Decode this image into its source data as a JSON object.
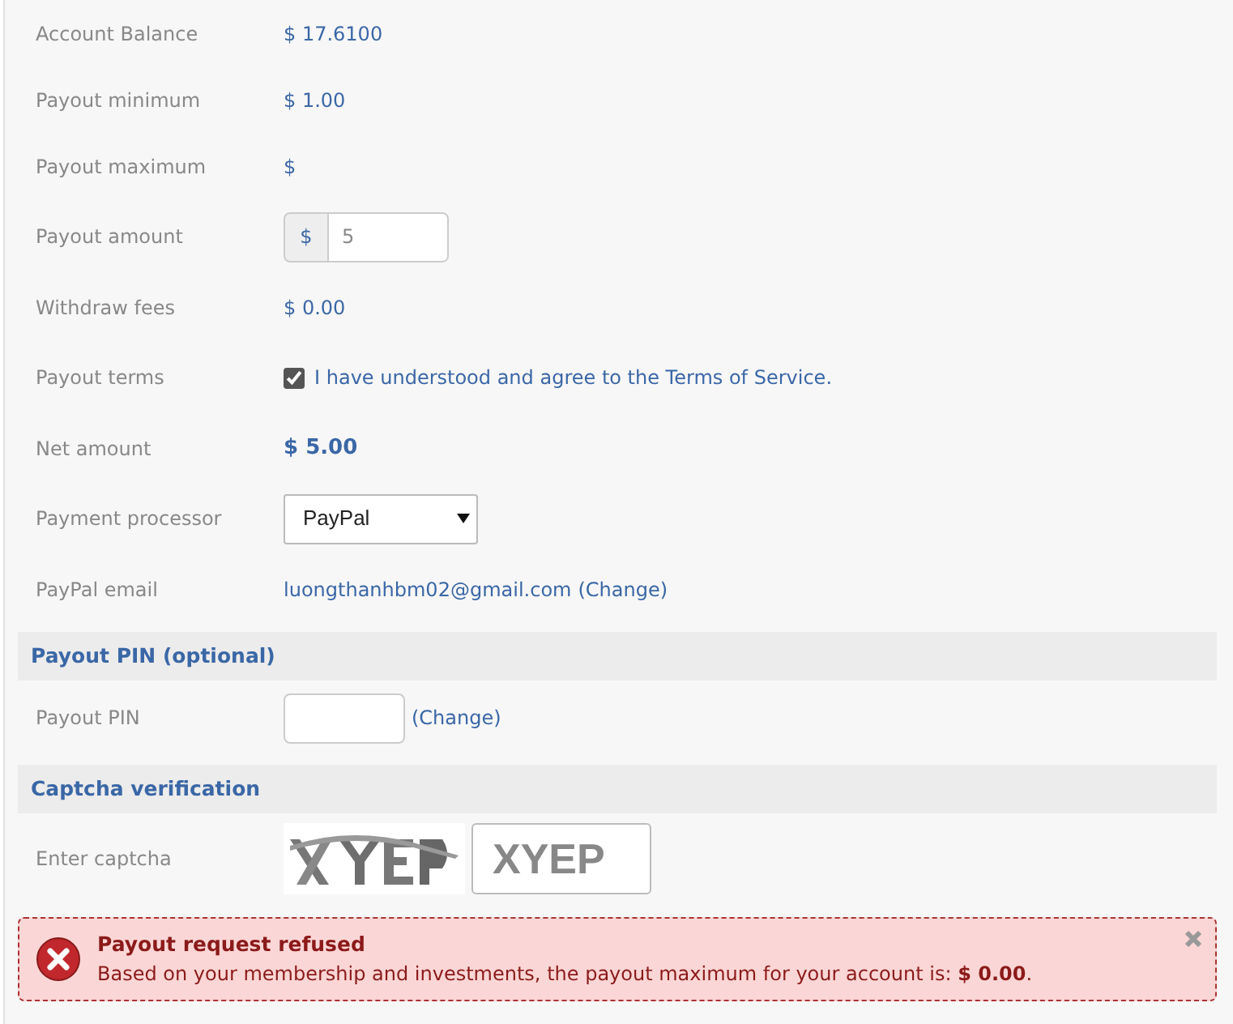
{
  "fields": [
    {
      "label": "Account Balance",
      "kind": "text",
      "value": "$ 17.6100"
    },
    {
      "label": "Payout minimum",
      "kind": "text",
      "value": "$ 1.00"
    },
    {
      "label": "Payout maximum",
      "kind": "text",
      "value": "$"
    },
    {
      "label": "Payout amount",
      "kind": "amount",
      "prefix": "$",
      "value": "5"
    },
    {
      "label": "Withdraw fees",
      "kind": "text",
      "value": "$ 0.00"
    },
    {
      "label": "Payout terms",
      "kind": "checkbox",
      "checked": true,
      "value": "I have understood and agree to the Terms of Service."
    },
    {
      "label": "Net amount",
      "kind": "text",
      "strong": true,
      "value": "$ 5.00"
    },
    {
      "label": "Payment processor",
      "kind": "select",
      "value": "PayPal"
    },
    {
      "label": "PayPal email",
      "kind": "link",
      "value": "luongthanhbm02@gmail.com",
      "action": "(Change)"
    }
  ],
  "sections": [
    {
      "title": "Payout PIN (optional)",
      "fields": [
        {
          "label": "Payout PIN",
          "kind": "pin",
          "action": "(Change)"
        }
      ]
    },
    {
      "title": "Captcha verification",
      "fields": [
        {
          "label": "Enter captcha",
          "kind": "captcha",
          "value": "XYEP"
        }
      ]
    }
  ],
  "alert": {
    "title": "Payout request refused",
    "message": "Based on your membership and investments, the payout maximum for your account is: **$ 0.00**."
  }
}
